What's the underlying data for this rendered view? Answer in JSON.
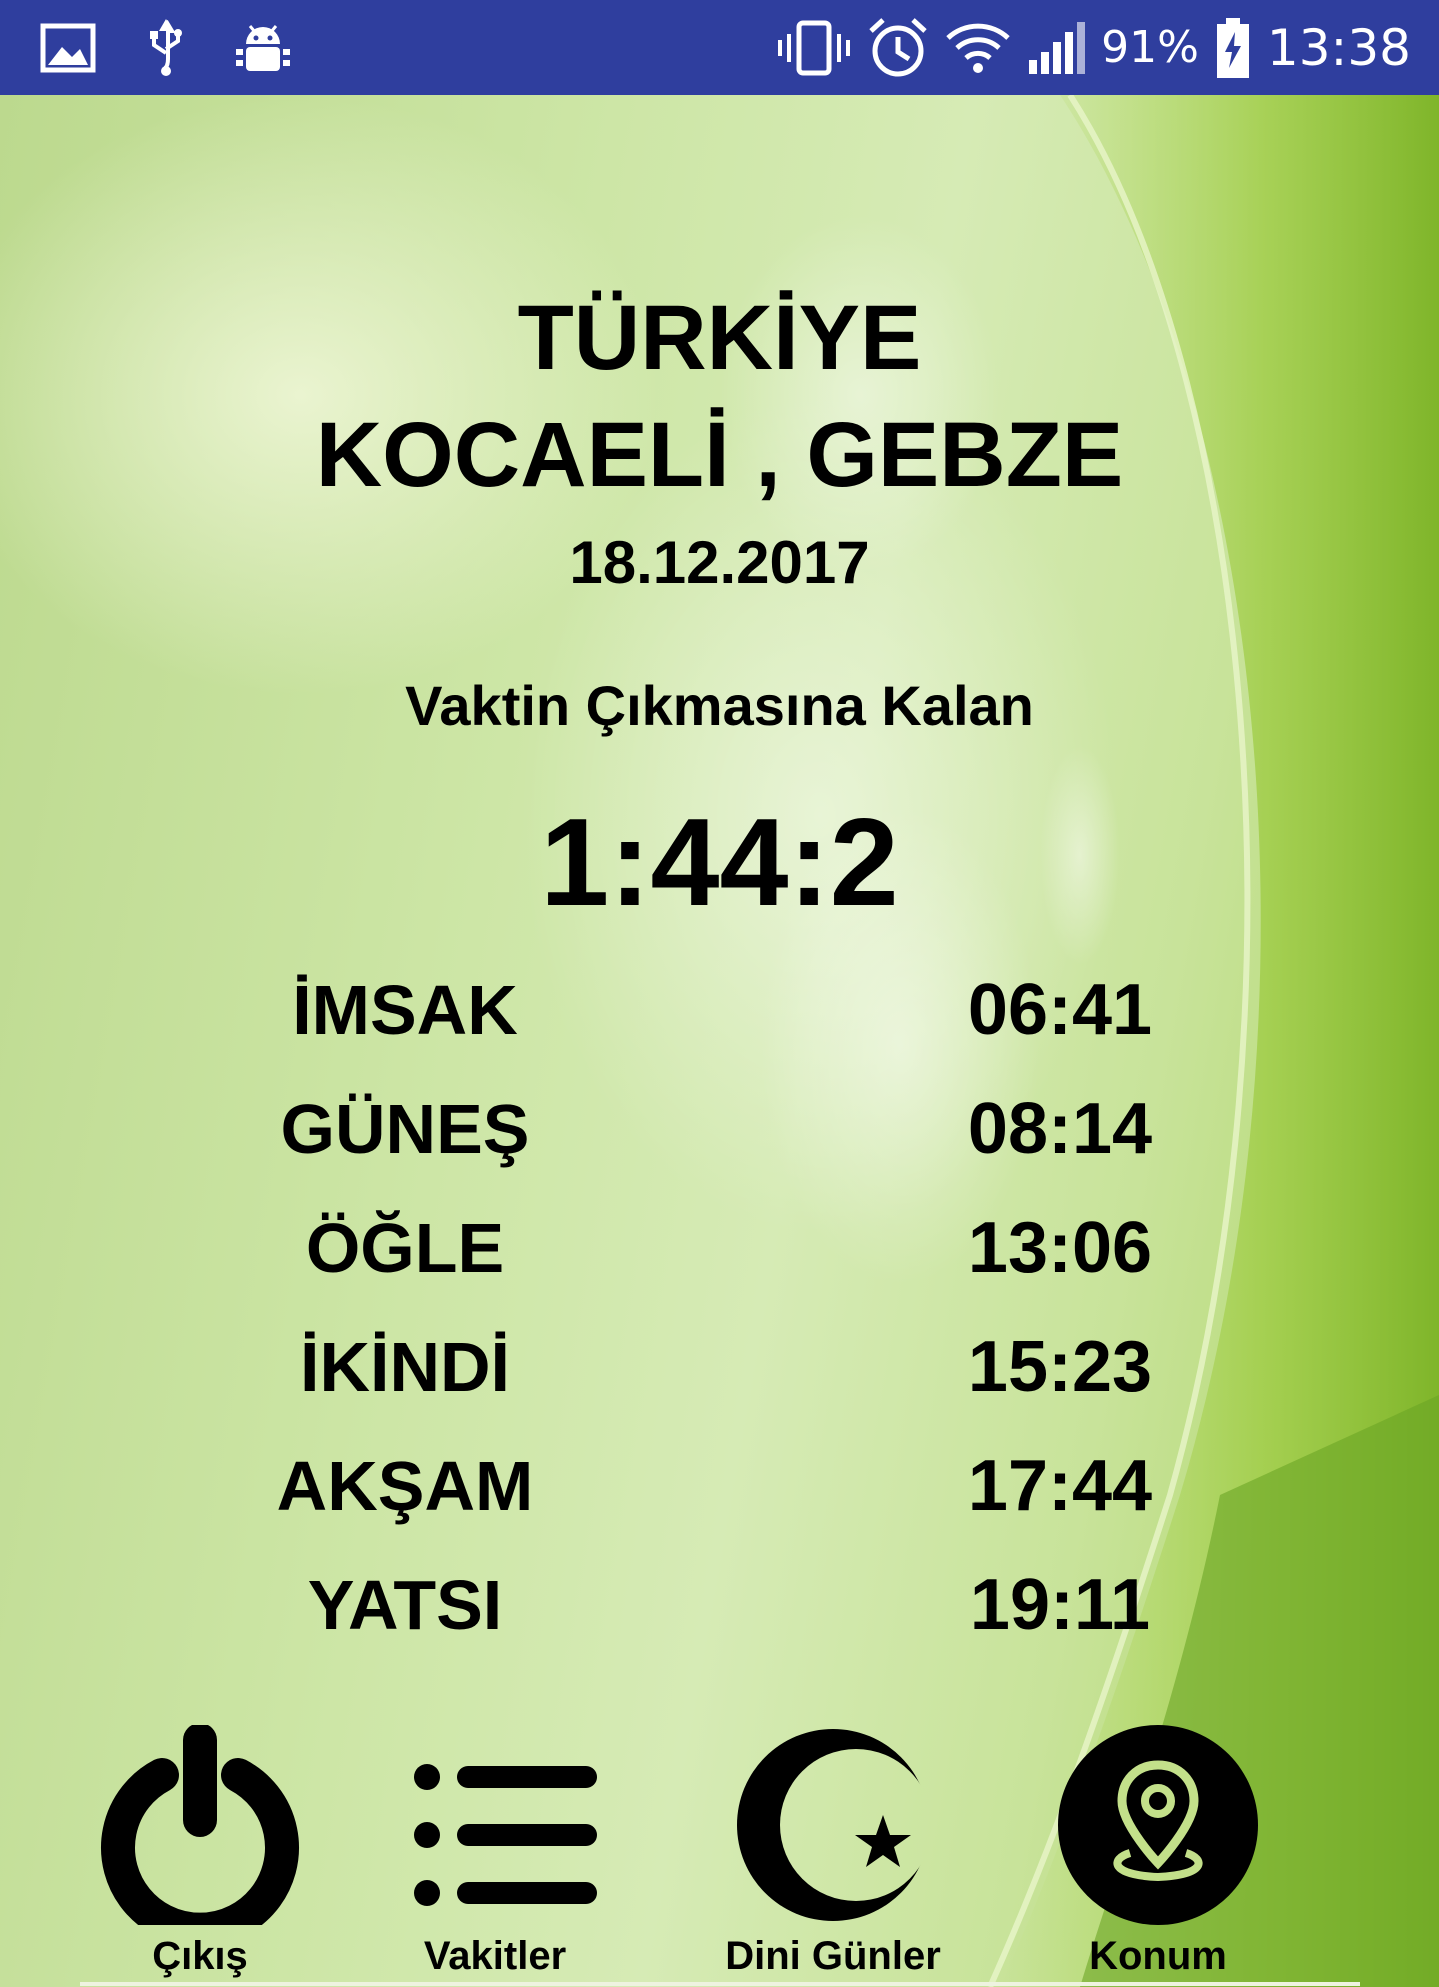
{
  "status_bar": {
    "battery": "91%",
    "clock": "13:38",
    "left_icons": [
      "image-icon",
      "usb-icon",
      "android-debug-icon"
    ],
    "right_icons": [
      "vibrate-icon",
      "alarm-icon",
      "wifi-icon",
      "signal-icon",
      "battery-charging-icon"
    ],
    "background": "#2f3e9e"
  },
  "header": {
    "country": "TÜRKİYE",
    "city": "KOCAELİ , GEBZE",
    "date": "18.12.2017"
  },
  "countdown": {
    "label": "Vaktin Çıkmasına Kalan",
    "value": "1:44:2"
  },
  "prayer_times": [
    {
      "name": "İMSAK",
      "time": "06:41"
    },
    {
      "name": "GÜNEŞ",
      "time": "08:14"
    },
    {
      "name": "ÖĞLE",
      "time": "13:06"
    },
    {
      "name": "İKİNDİ",
      "time": "15:23"
    },
    {
      "name": "AKŞAM",
      "time": "17:44"
    },
    {
      "name": "YATSI",
      "time": "19:11"
    }
  ],
  "nav": {
    "items": [
      {
        "label": "Çıkış",
        "icon": "power-icon"
      },
      {
        "label": "Vakitler",
        "icon": "list-icon"
      },
      {
        "label": "Dini Günler",
        "icon": "crescent-star-icon"
      },
      {
        "label": "Konum",
        "icon": "location-pin-icon"
      }
    ]
  },
  "colors": {
    "accent_green": "#a9d35a",
    "text": "#000000"
  }
}
